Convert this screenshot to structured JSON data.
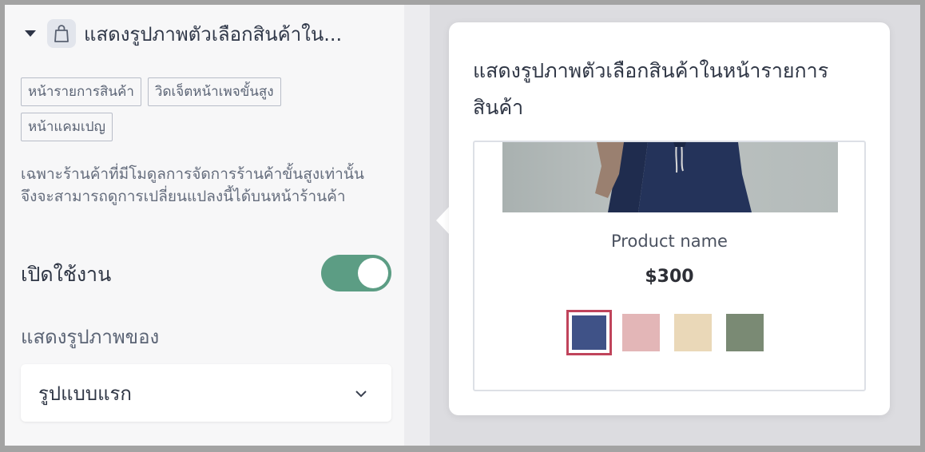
{
  "header": {
    "title": "แสดงรูปภาพตัวเลือกสินค้าใน...",
    "caret_icon": "caret-down-icon",
    "icon": "shopping-bag-icon"
  },
  "tags": [
    "หน้ารายการสินค้า",
    "วิดเจ็ตหน้าเพจขั้นสูง",
    "หน้าแคมเปญ"
  ],
  "description": "เฉพาะร้านค้าที่มีโมดูลการจัดการร้านค้าขั้นสูงเท่านั้นจึงจะสามารถดูการเปลี่ยนแปลงนี้ได้บนหน้าร้านค้า",
  "enable": {
    "label": "เปิดใช้งาน",
    "on": true
  },
  "show_image": {
    "label": "แสดงรูปภาพของ",
    "selected": "รูปแบบแรก",
    "chevron_icon": "chevron-down-icon"
  },
  "popover": {
    "title_line1": "แสดงรูปภาพตัวเลือกสินค้าในหน้ารายการ",
    "title_line2": "สินค้า",
    "product_name": "Product name",
    "price": "$300",
    "swatches": [
      {
        "color": "#3f5287",
        "selected": true
      },
      {
        "color": "#e3b6b7",
        "selected": false
      },
      {
        "color": "#ead8b8",
        "selected": false
      },
      {
        "color": "#7a8a74",
        "selected": false
      }
    ]
  },
  "colors": {
    "toggle_on": "#5c9d84",
    "selected_outline": "#c0445b"
  }
}
